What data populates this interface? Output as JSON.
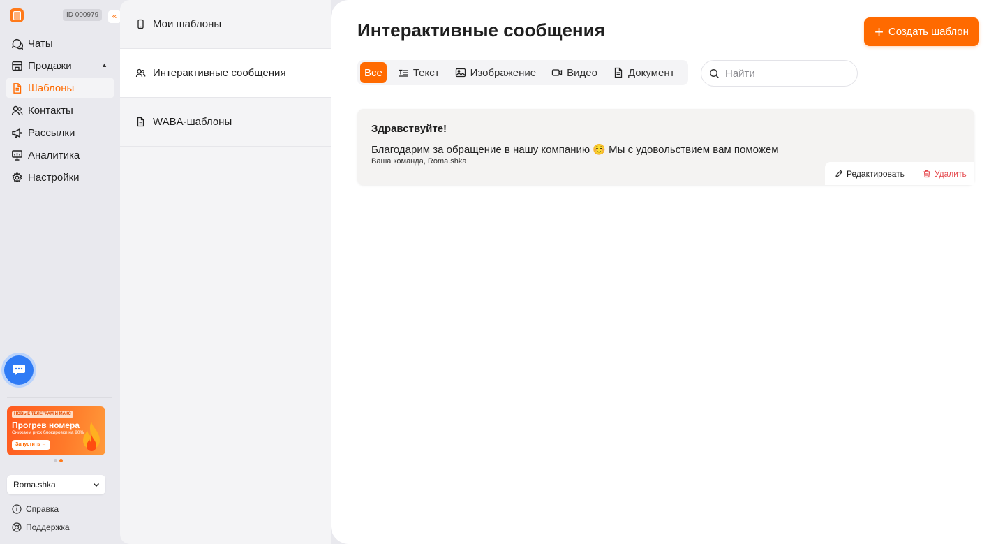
{
  "account_id": "ID 000979",
  "collapse_glyph": "«",
  "nav": [
    {
      "label": "Чаты",
      "icon": "chat-icon"
    },
    {
      "label": "Продажи",
      "icon": "store-icon"
    },
    {
      "label": "Шаблоны",
      "icon": "template-icon",
      "active": true
    },
    {
      "label": "Контакты",
      "icon": "contacts-icon"
    },
    {
      "label": "Рассылки",
      "icon": "megaphone-icon"
    },
    {
      "label": "Аналитика",
      "icon": "analytics-icon"
    },
    {
      "label": "Настройки",
      "icon": "gear-icon"
    }
  ],
  "promo": {
    "tag": "НОВЫЕ ТЕЛЕГРАМ И МАКС",
    "title": "Прогрев номера",
    "subtitle": "Снижаем риск блокировки на 90%",
    "button": "Запустить →"
  },
  "account_name": "Roma.shka",
  "footer": {
    "help": "Справка",
    "support": "Поддержка"
  },
  "template_sections": [
    {
      "label": "Мои шаблоны",
      "icon": "phone-icon"
    },
    {
      "label": "Интерактивные сообщения",
      "icon": "users-icon",
      "active": true
    },
    {
      "label": "WABA-шаблоны",
      "icon": "document-icon"
    }
  ],
  "page_title": "Интерактивные сообщения",
  "create_button": "Создать шаблон",
  "filters": [
    {
      "label": "Все",
      "active": true
    },
    {
      "label": "Текст",
      "icon": "text-icon"
    },
    {
      "label": "Изображение",
      "icon": "image-icon"
    },
    {
      "label": "Видео",
      "icon": "video-icon"
    },
    {
      "label": "Документ",
      "icon": "document-icon"
    }
  ],
  "search_placeholder": "Найти",
  "card": {
    "title": "Здравствуйте!",
    "text": "Благодарим за обращение в нашу компанию ☺️ Мы с удовольствием вам поможем",
    "signature": "Ваша команда, Roma.shka",
    "edit": "Редактировать",
    "delete": "Удалить"
  },
  "colors": {
    "accent": "#ff6a00",
    "danger": "#e5484d",
    "chat_fab": "#2f7bf5"
  }
}
